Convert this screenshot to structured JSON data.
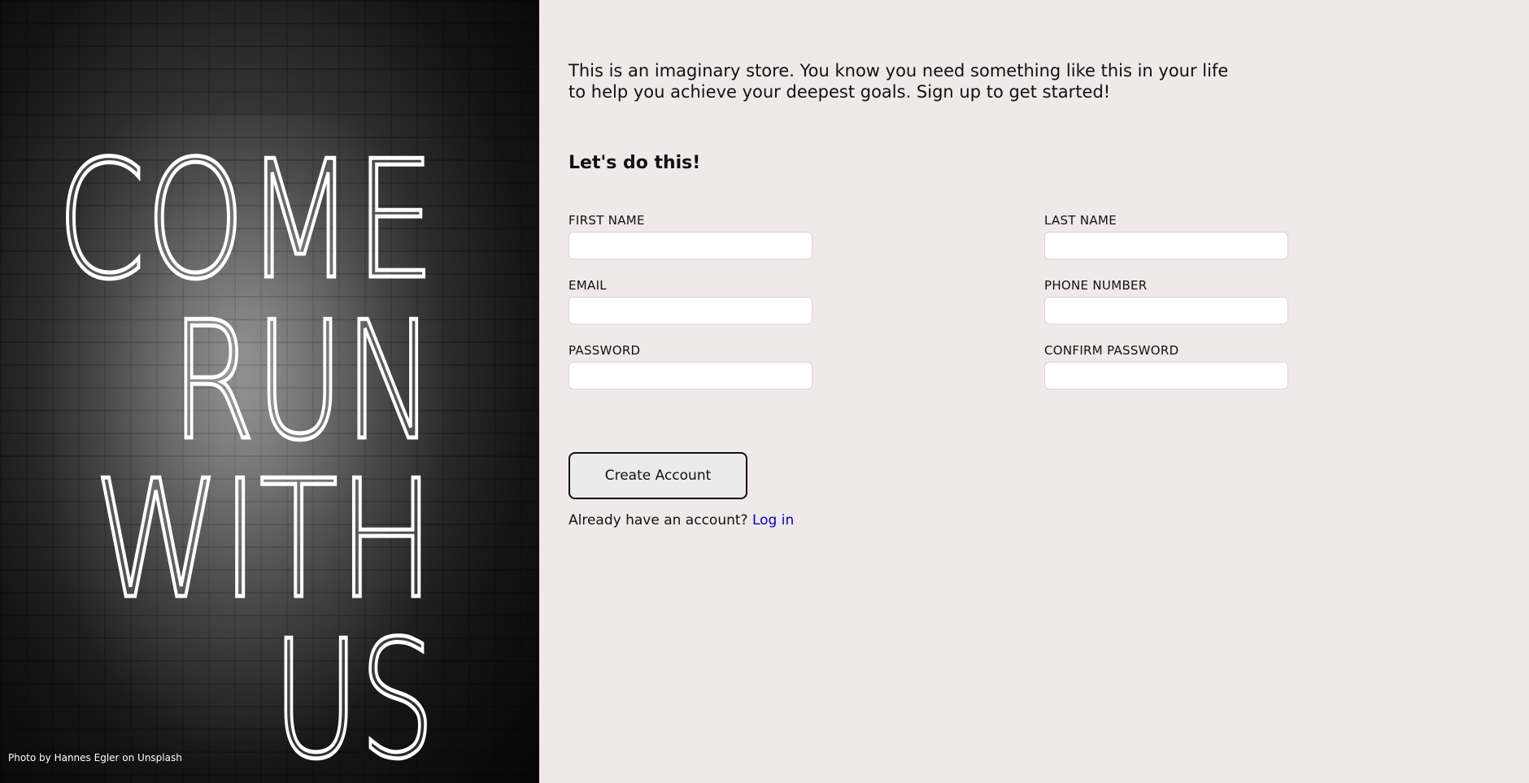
{
  "hero": {
    "neon_lines": [
      "COME",
      "RUN",
      "WITH",
      "US"
    ],
    "photo_credit": "Photo by Hannes Egler on Unsplash"
  },
  "intro": {
    "text": "This is an imaginary store. You know you need something like this in your life to help you achieve your deepest goals. Sign up to get started!"
  },
  "form": {
    "heading": "Let's do this!",
    "fields": {
      "first_name": {
        "label": "FIRST NAME",
        "value": "",
        "placeholder": ""
      },
      "last_name": {
        "label": "LAST NAME",
        "value": "",
        "placeholder": ""
      },
      "email": {
        "label": "EMAIL",
        "value": "",
        "placeholder": ""
      },
      "phone": {
        "label": "PHONE NUMBER",
        "value": "",
        "placeholder": ""
      },
      "password": {
        "label": "PASSWORD",
        "value": "",
        "placeholder": ""
      },
      "confirm_password": {
        "label": "CONFIRM PASSWORD",
        "value": "",
        "placeholder": ""
      }
    },
    "submit_label": "Create Account",
    "login_prompt": "Already have an account?",
    "login_link": "Log in"
  },
  "colors": {
    "background": "#efe9e9",
    "link": "#0000cc",
    "text": "#111111"
  }
}
